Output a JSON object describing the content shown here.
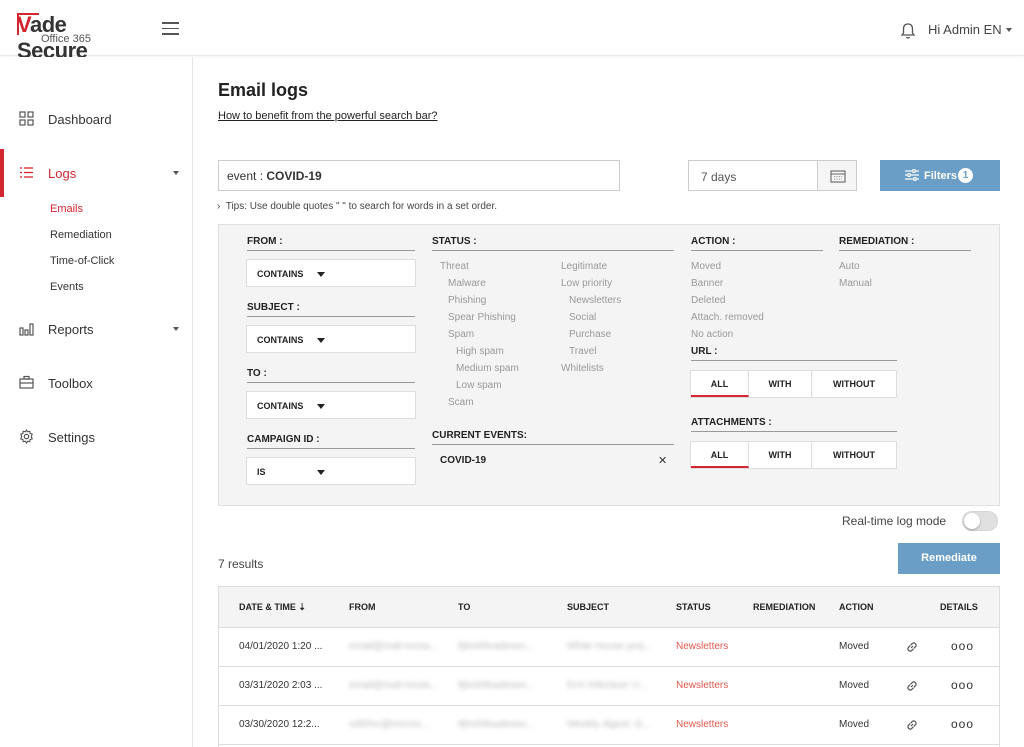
{
  "header": {
    "logo_main": "ade Secure",
    "logo_v": "V",
    "logo_sub": "Office 365",
    "user_label": "Hi Admin EN"
  },
  "sidebar": {
    "items": [
      {
        "label": "Dashboard",
        "icon": "grid-icon"
      },
      {
        "label": "Logs",
        "icon": "list-icon"
      },
      {
        "label": "Reports",
        "icon": "bar-chart-icon"
      },
      {
        "label": "Toolbox",
        "icon": "toolbox-icon"
      },
      {
        "label": "Settings",
        "icon": "gear-icon"
      }
    ],
    "logs_sub": [
      "Emails",
      "Remediation",
      "Time-of-Click",
      "Events"
    ]
  },
  "main": {
    "title": "Email logs",
    "help_link": "How to benefit from the powerful search bar?",
    "search_prefix": "event : ",
    "search_value": "COVID-19",
    "date_range": "7 days",
    "filters_label": "Filters",
    "filters_count": "1",
    "tips": "Tips: Use double quotes \" \" to search for words in a set order."
  },
  "panel": {
    "from_title": "FROM :",
    "from_value": "CONTAINS",
    "subject_title": "SUBJECT :",
    "subject_value": "CONTAINS",
    "to_title": "TO :",
    "to_value": "CONTAINS",
    "campaign_title": "CAMPAIGN ID :",
    "campaign_value": "IS",
    "status_title": "STATUS :",
    "status_col1": [
      "Threat",
      "Malware",
      "Phishing",
      "Spear Phishing",
      "Spam",
      "High spam",
      "Medium spam",
      "Low spam",
      "Scam"
    ],
    "status_col2": [
      "Legitimate",
      "Low priority",
      "Newsletters",
      "Social",
      "Purchase",
      "Travel",
      "Whitelists"
    ],
    "current_events_title": "CURRENT EVENTS:",
    "current_event": "COVID-19",
    "action_title": "ACTION :",
    "actions": [
      "Moved",
      "Banner",
      "Deleted",
      "Attach. removed",
      "No action"
    ],
    "remediation_title": "REMEDIATION :",
    "remediations": [
      "Auto",
      "Manual"
    ],
    "url_title": "URL :",
    "url_opts": [
      "ALL",
      "WITH",
      "WITHOUT"
    ],
    "attachments_title": "ATTACHMENTS :",
    "attach_opts": [
      "ALL",
      "WITH",
      "WITHOUT"
    ]
  },
  "realtime_label": "Real-time log mode",
  "results_label": "7 results",
  "remediate_label": "Remediate",
  "table": {
    "headers": [
      "DATE & TIME",
      "FROM",
      "TO",
      "SUBJECT",
      "STATUS",
      "REMEDIATION",
      "ACTION",
      "DETAILS"
    ],
    "rows": [
      {
        "date": "04/01/2020 1:20 ...",
        "from": "email@mail-mcsis...",
        "to": "ltjhcl49vadesec...",
        "subject": "White House proj...",
        "status": "Newsletters",
        "action": "Moved"
      },
      {
        "date": "03/31/2020 2:03 ...",
        "from": "email@mail-mcsis...",
        "to": "ltjhcl49vadesec...",
        "subject": "Erm Infectiuer U...",
        "status": "Newsletters",
        "action": "Moved"
      },
      {
        "date": "03/30/2020 12:2...",
        "from": "s360nc@micros...",
        "to": "ltjhcl49vadesec...",
        "subject": "Weekly digest: G...",
        "status": "Newsletters",
        "action": "Moved"
      }
    ],
    "details_glyph": "ooo"
  },
  "colors": {
    "accent": "#d22630",
    "button": "#6a9ec7",
    "status_red": "#e2574c"
  }
}
